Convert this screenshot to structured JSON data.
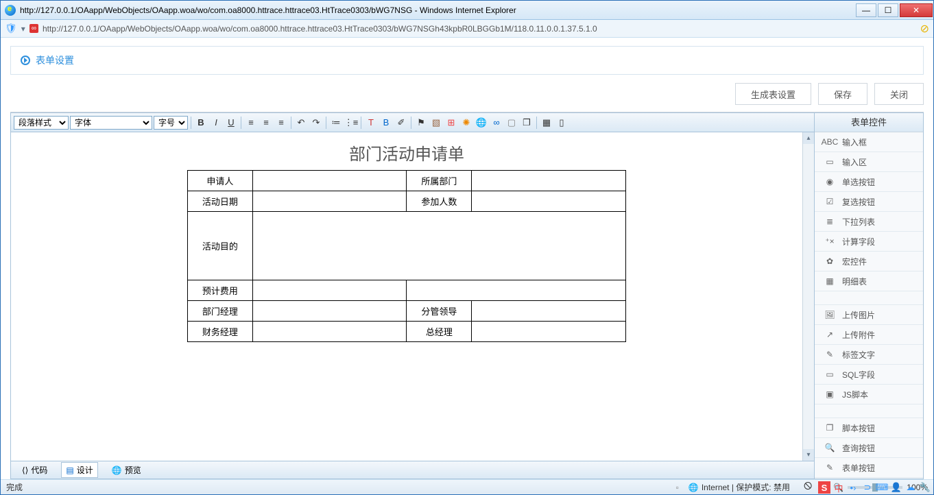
{
  "window": {
    "title": "http://127.0.0.1/OAapp/WebObjects/OAapp.woa/wo/com.oa8000.httrace.httrace03.HtTrace0303/bWG7NSG - Windows Internet Explorer"
  },
  "addressbar": {
    "url": "http://127.0.0.1/OAapp/WebObjects/OAapp.woa/wo/com.oa8000.httrace.httrace03.HtTrace0303/bWG7NSGh43kpbR0LBGGb1M/118.0.11.0.0.1.37.5.1.0"
  },
  "page": {
    "title": "表单设置"
  },
  "actions": {
    "generate": "生成表设置",
    "save": "保存",
    "close": "关闭"
  },
  "editor": {
    "para_style": "段落样式",
    "font": "字体",
    "size": "字号"
  },
  "form": {
    "title": "部门活动申请单",
    "rows": {
      "applicant": "申请人",
      "department": "所属部门",
      "date": "活动日期",
      "people": "参加人数",
      "purpose": "活动目的",
      "budget": "预计费用",
      "dept_mgr": "部门经理",
      "leader": "分管领导",
      "fin_mgr": "财务经理",
      "gm": "总经理"
    }
  },
  "tabs": {
    "code": "代码",
    "design": "设计",
    "preview": "预览"
  },
  "side": {
    "title": "表单控件",
    "items": [
      {
        "icon": "ABC",
        "label": "输入框"
      },
      {
        "icon": "▭",
        "label": "输入区"
      },
      {
        "icon": "◉",
        "label": "单选按钮"
      },
      {
        "icon": "☑",
        "label": "复选按钮"
      },
      {
        "icon": "≣",
        "label": "下拉列表"
      },
      {
        "icon": "⁺×",
        "label": "计算字段"
      },
      {
        "icon": "✿",
        "label": "宏控件"
      },
      {
        "icon": "▦",
        "label": "明细表"
      }
    ],
    "items2": [
      {
        "icon": "🖼",
        "label": "上传图片"
      },
      {
        "icon": "↗",
        "label": "上传附件"
      },
      {
        "icon": "✎",
        "label": "标签文字"
      },
      {
        "icon": "▭",
        "label": "SQL字段"
      },
      {
        "icon": "▣",
        "label": "JS脚本"
      }
    ],
    "items3": [
      {
        "icon": "❐",
        "label": "脚本按钮"
      },
      {
        "icon": "🔍",
        "label": "查询按钮"
      },
      {
        "icon": "✎",
        "label": "表单按钮"
      }
    ]
  },
  "status": {
    "done": "完成",
    "zone": "Internet | 保护模式: 禁用",
    "zoom": "100%"
  }
}
